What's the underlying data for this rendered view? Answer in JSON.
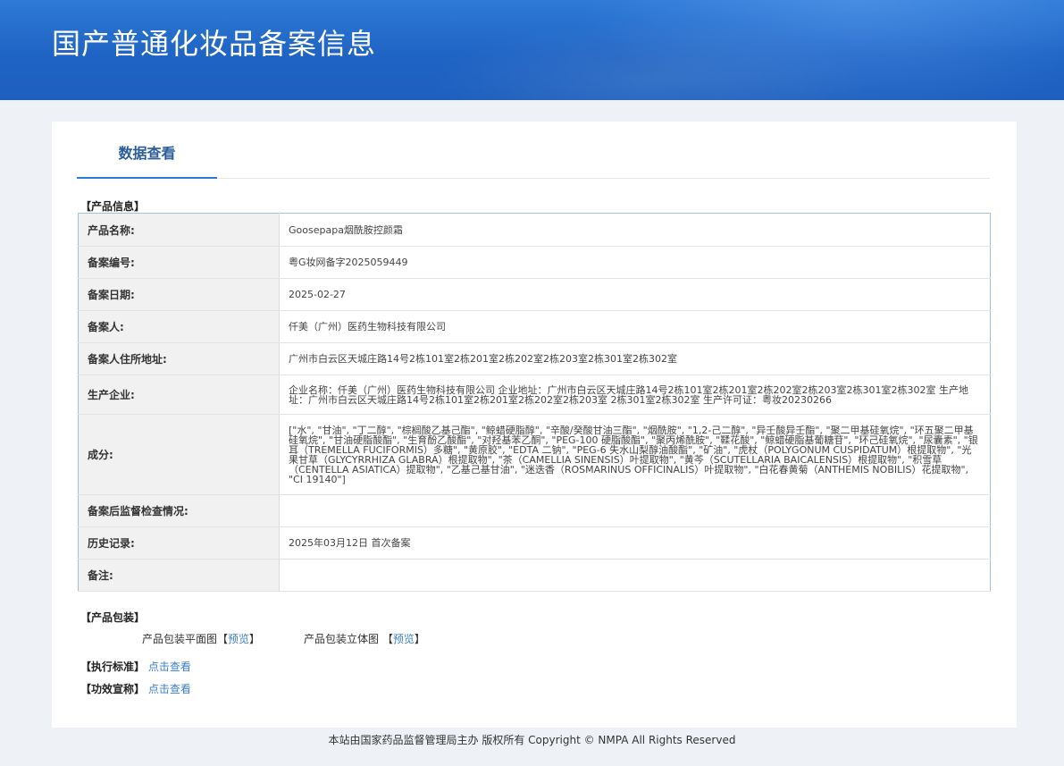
{
  "header": {
    "title": "国产普通化妆品备案信息"
  },
  "tabs": [
    {
      "label": "数据查看"
    }
  ],
  "product_info": {
    "section_title": "【产品信息】",
    "rows": [
      {
        "label": "产品名称:",
        "value": "Goosepapa烟酰胺控颜霜"
      },
      {
        "label": "备案编号:",
        "value": "粤G妆网备字2025059449"
      },
      {
        "label": "备案日期:",
        "value": "2025-02-27"
      },
      {
        "label": "备案人:",
        "value": "仟美（广州）医药生物科技有限公司"
      },
      {
        "label": "备案人住所地址:",
        "value": "广州市白云区天城庄路14号2栋101室2栋201室2栋202室2栋203室2栋301室2栋302室"
      },
      {
        "label": "生产企业:",
        "value": "企业名称：仟美（广州）医药生物科技有限公司 企业地址：广州市白云区天城庄路14号2栋101室2栋201室2栋202室2栋203室2栋301室2栋302室 生产地址：广州市白云区天城庄路14号2栋101室2栋201室2栋202室2栋203室 2栋301室2栋302室 生产许可证：粤妆20230266"
      },
      {
        "label": "成分:",
        "value": "[\"水\", \"甘油\", \"丁二醇\", \"棕榈酸乙基己酯\", \"鲸蜡硬脂醇\", \"辛酸/癸酸甘油三酯\", \"烟酰胺\", \"1,2-己二醇\", \"异壬酸异壬酯\", \"聚二甲基硅氧烷\", \"环五聚二甲基硅氧烷\", \"甘油硬脂酸酯\", \"生育酚乙酸酯\", \"对羟基苯乙酮\", \"PEG-100 硬脂酸酯\", \"聚丙烯酰胺\", \"鞣花酸\", \"鲸蜡硬脂基葡糖苷\", \"环己硅氧烷\", \"尿囊素\", \"银耳（TREMELLA FUCIFORMIS）多糖\", \"黄原胶\", \"EDTA 二钠\", \"PEG-6 失水山梨醇油酸酯\", \"矿油\", \"虎杖（POLYGONUM CUSPIDATUM）根提取物\", \"光果甘草（GLYCYRRHIZA GLABRA）根提取物\", \"茶（CAMELLIA SINENSIS）叶提取物\", \"黄芩（SCUTELLARIA BAICALENSIS）根提取物\", \"积雪草（CENTELLA ASIATICA）提取物\", \"乙基己基甘油\", \"迷迭香（ROSMARINUS OFFICINALIS）叶提取物\", \"白花春黄菊（ANTHEMIS NOBILIS）花提取物\", \"CI 19140\"]"
      },
      {
        "label": "备案后监督检查情况:",
        "value": ""
      },
      {
        "label": "历史记录:",
        "value": "2025年03月12日 首次备案"
      },
      {
        "label": "备注:",
        "value": ""
      }
    ]
  },
  "packaging": {
    "section_title": "【产品包装】",
    "flat_label": "产品包装平面图",
    "stereo_label": "产品包装立体图",
    "bracket_open": "【",
    "bracket_close": "】",
    "preview_link": "预览"
  },
  "standard": {
    "label": "【执行标准】",
    "link": "点击查看"
  },
  "efficacy": {
    "label": "【功效宣称】",
    "link": "点击查看"
  },
  "footer": {
    "text": "本站由国家药品监督管理局主办 版权所有 Copyright © NMPA All Rights Reserved"
  },
  "colors": {
    "banner": "#1f64c4",
    "link": "#3c7fc8",
    "tab_text": "#2b5c9a",
    "table_border": "#a9bfd6"
  }
}
